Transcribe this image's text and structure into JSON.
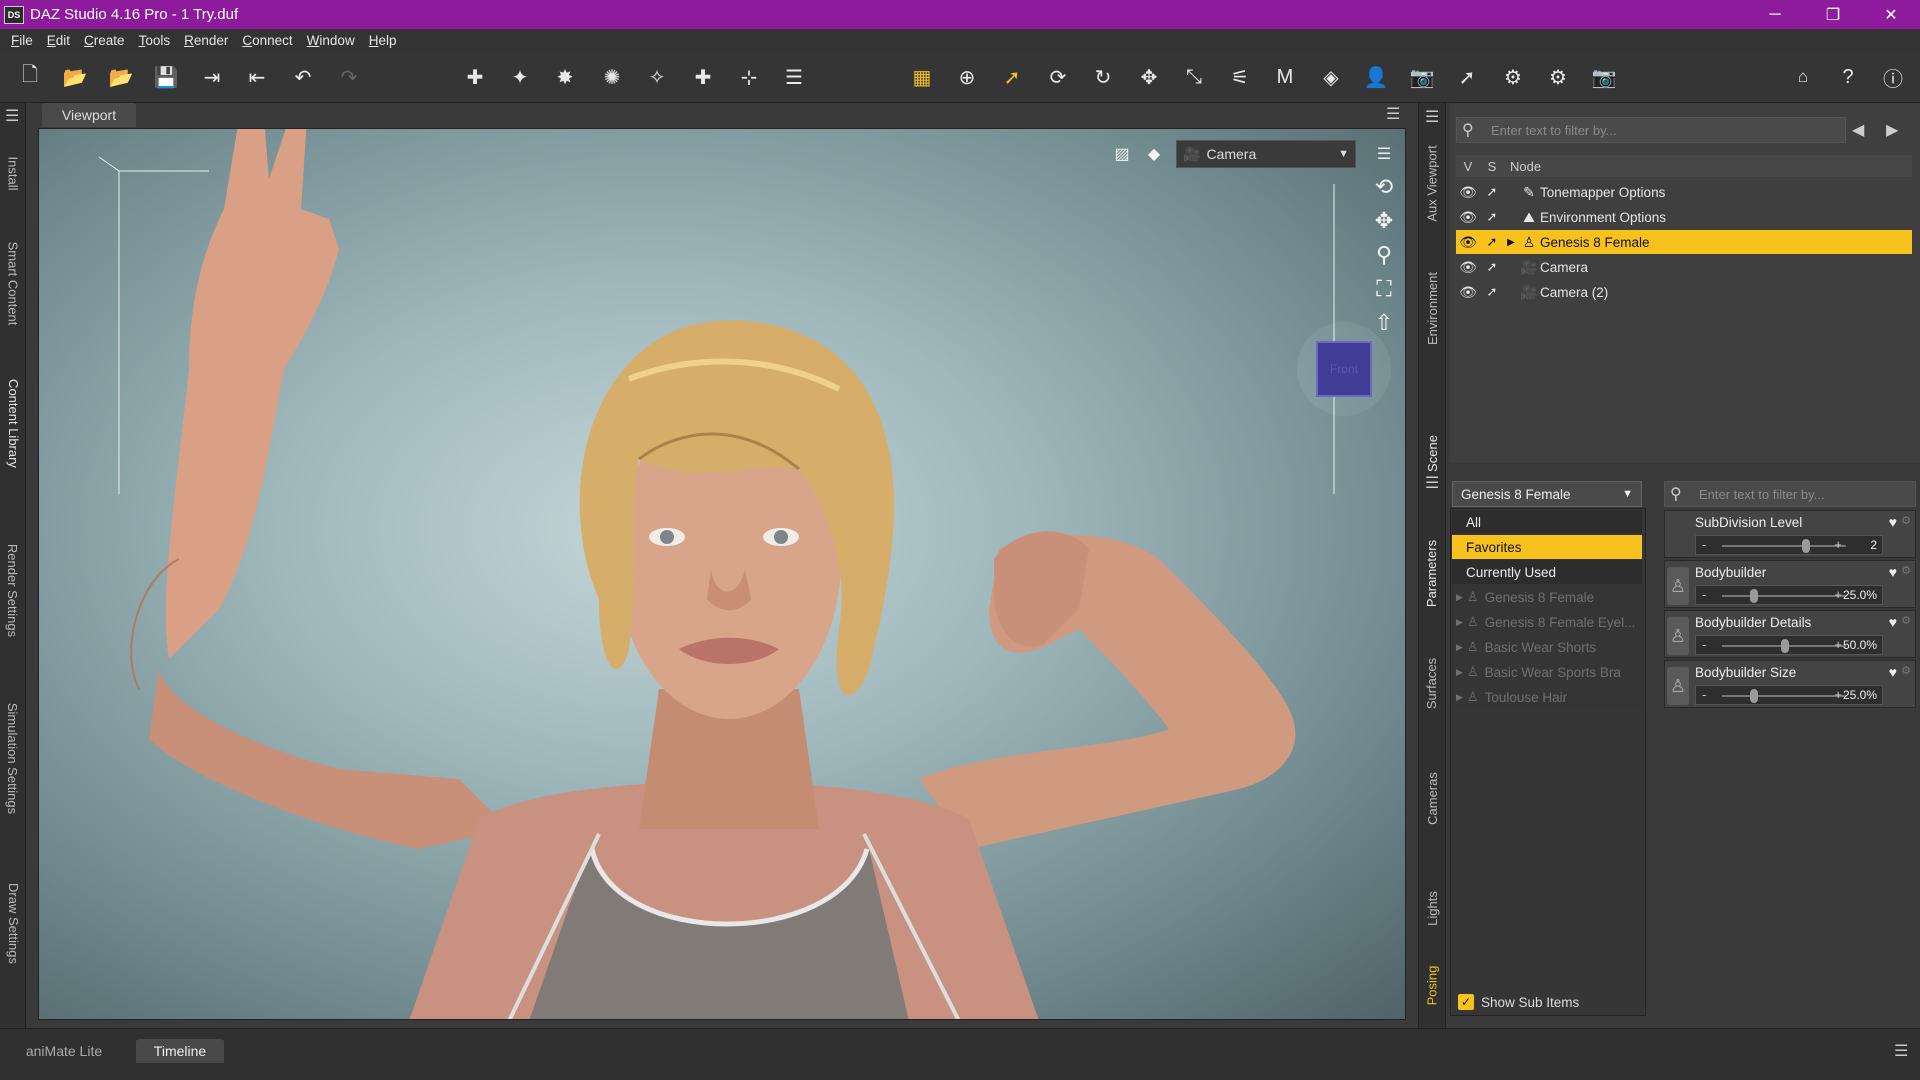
{
  "window": {
    "title": "DAZ Studio 4.16 Pro - 1 Try.duf",
    "logo": "DS",
    "minimize": "─",
    "restore": "❐",
    "close": "✕"
  },
  "menu": [
    "File",
    "Edit",
    "Create",
    "Tools",
    "Render",
    "Connect",
    "Window",
    "Help"
  ],
  "left_tabs": [
    "Install",
    "Smart Content",
    "Content Library",
    "Render Settings",
    "Simulation Settings",
    "Draw Settings"
  ],
  "viewport": {
    "tab_label": "Viewport",
    "camera": "Camera",
    "cube_label": "Front"
  },
  "right_tabs": [
    "Aux Viewport",
    "Environment",
    "Scene",
    "Parameters",
    "Surfaces",
    "Cameras",
    "Lights",
    "Posing"
  ],
  "scene": {
    "filter_placeholder": "Enter text to filter by...",
    "col_v": "V",
    "col_s": "S",
    "col_node": "Node",
    "nodes": [
      {
        "label": "Tonemapper Options"
      },
      {
        "label": "Environment Options"
      },
      {
        "label": "Genesis 8 Female"
      },
      {
        "label": "Camera"
      },
      {
        "label": "Camera (2)"
      }
    ]
  },
  "parameters": {
    "node_select": "Genesis 8 Female",
    "filter_placeholder": "Enter text to filter by...",
    "categories": [
      "All",
      "Favorites",
      "Currently Used"
    ],
    "sub_items": [
      "Genesis 8 Female",
      "Genesis 8 Female Eyel...",
      "Basic Wear Shorts",
      "Basic Wear Sports Bra",
      "Toulouse Hair"
    ],
    "sliders": [
      {
        "name": "SubDivision Level",
        "value": "2",
        "fraction": 0.667
      },
      {
        "name": "Bodybuilder",
        "value": "25.0%",
        "fraction": 0.25
      },
      {
        "name": "Bodybuilder Details",
        "value": "50.0%",
        "fraction": 0.5
      },
      {
        "name": "Bodybuilder Size",
        "value": "25.0%",
        "fraction": 0.25
      }
    ],
    "show_sub_items": "Show Sub Items"
  },
  "bottom_tabs": [
    "aniMate Lite",
    "Timeline"
  ],
  "colors": {
    "title_bar": "#8e1b9b",
    "selection": "#f7c21d"
  }
}
